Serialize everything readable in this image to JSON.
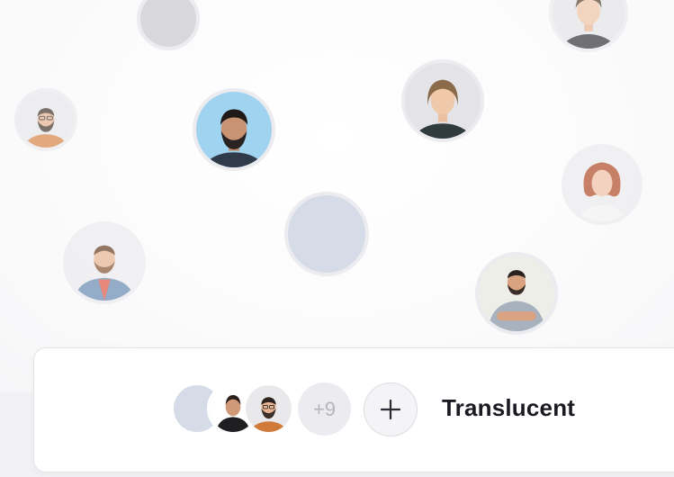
{
  "avatar_group": {
    "overflow_count_label": "+9",
    "variant_label": "Translucent",
    "add_icon": "plus-icon"
  },
  "colors": {
    "placeholder_avatar": "#d5dce7",
    "panel_background": "#ffffff",
    "overflow_badge": "#ececf0",
    "label_text": "#1a1a22"
  }
}
